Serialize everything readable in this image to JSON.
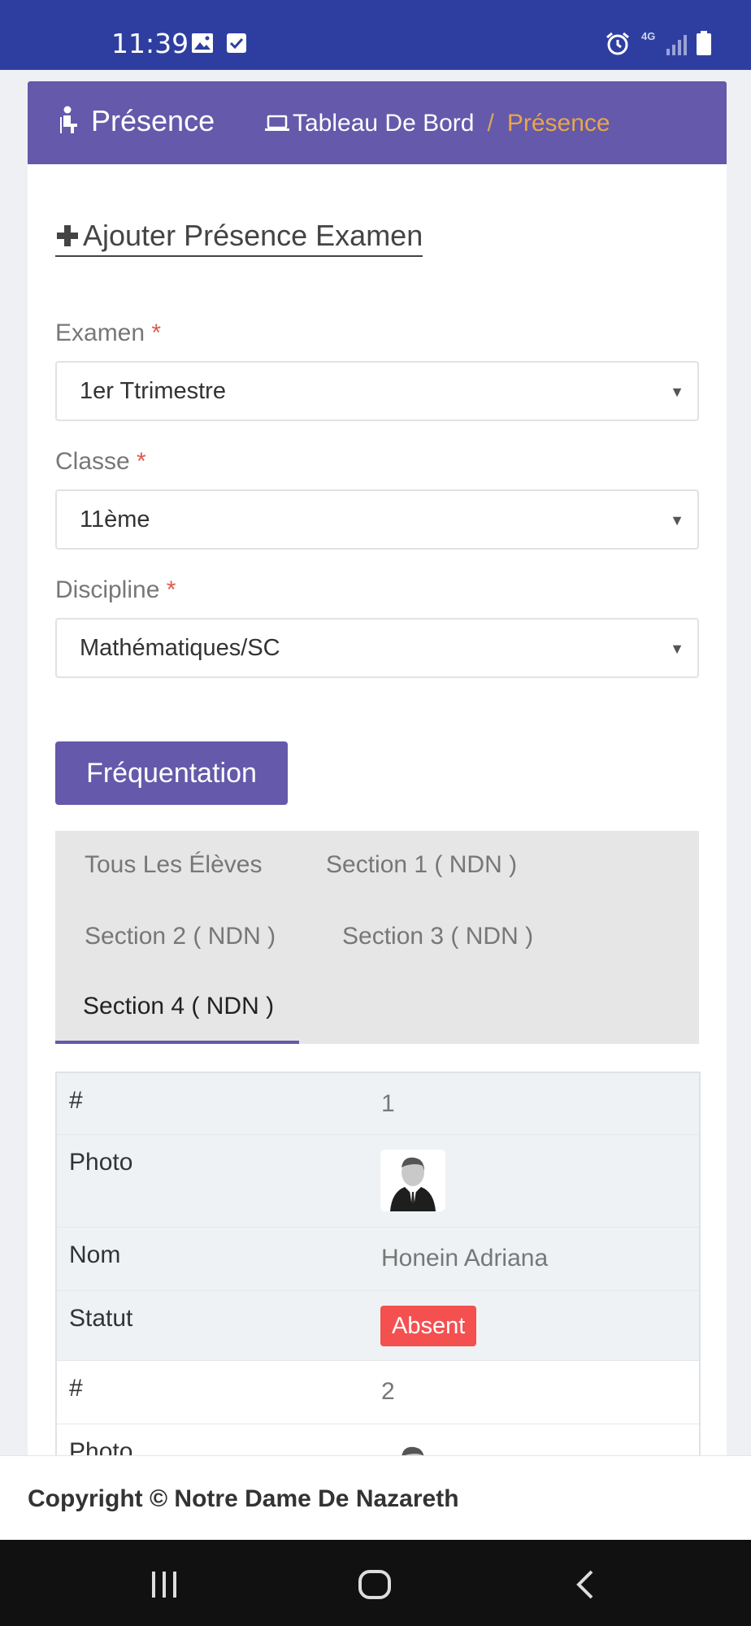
{
  "status_bar": {
    "time": "11:39",
    "network": "4G",
    "icons": [
      "gallery-icon",
      "checkbox-icon",
      "alarm-icon",
      "signal-icon",
      "battery-icon"
    ]
  },
  "header": {
    "icon": "person-seated-icon",
    "title": "Présence",
    "breadcrumb": {
      "home_icon": "laptop-icon",
      "home": "Tableau De Bord",
      "separator": "/",
      "current": "Présence"
    }
  },
  "form": {
    "add_link": "Ajouter Présence Examen",
    "required_mark": "*",
    "fields": [
      {
        "label": "Examen",
        "value": "1er Ttrimestre"
      },
      {
        "label": "Classe",
        "value": "11ème"
      },
      {
        "label": "Discipline",
        "value": "Mathématiques/SC"
      }
    ],
    "submit_label": "Fréquentation"
  },
  "tabs": [
    {
      "label": "Tous Les Élèves",
      "active": false
    },
    {
      "label": "Section 1 ( NDN )",
      "active": false
    },
    {
      "label": "Section 2 ( NDN )",
      "active": false
    },
    {
      "label": "Section 3 ( NDN )",
      "active": false
    },
    {
      "label": "Section 4 ( NDN )",
      "active": true
    }
  ],
  "table": {
    "keys": {
      "num": "#",
      "photo": "Photo",
      "name": "Nom",
      "status": "Statut"
    },
    "students": [
      {
        "num": "1",
        "name": "Honein Adriana",
        "status": "Absent"
      },
      {
        "num": "2"
      }
    ]
  },
  "footer": {
    "text": "Copyright © Notre Dame De Nazareth"
  },
  "colors": {
    "status_bar": "#2e3ea0",
    "primary": "#6459aa",
    "breadcrumb_active": "#e8a54b",
    "required": "#e05a4a",
    "absent_badge": "#f45050"
  }
}
